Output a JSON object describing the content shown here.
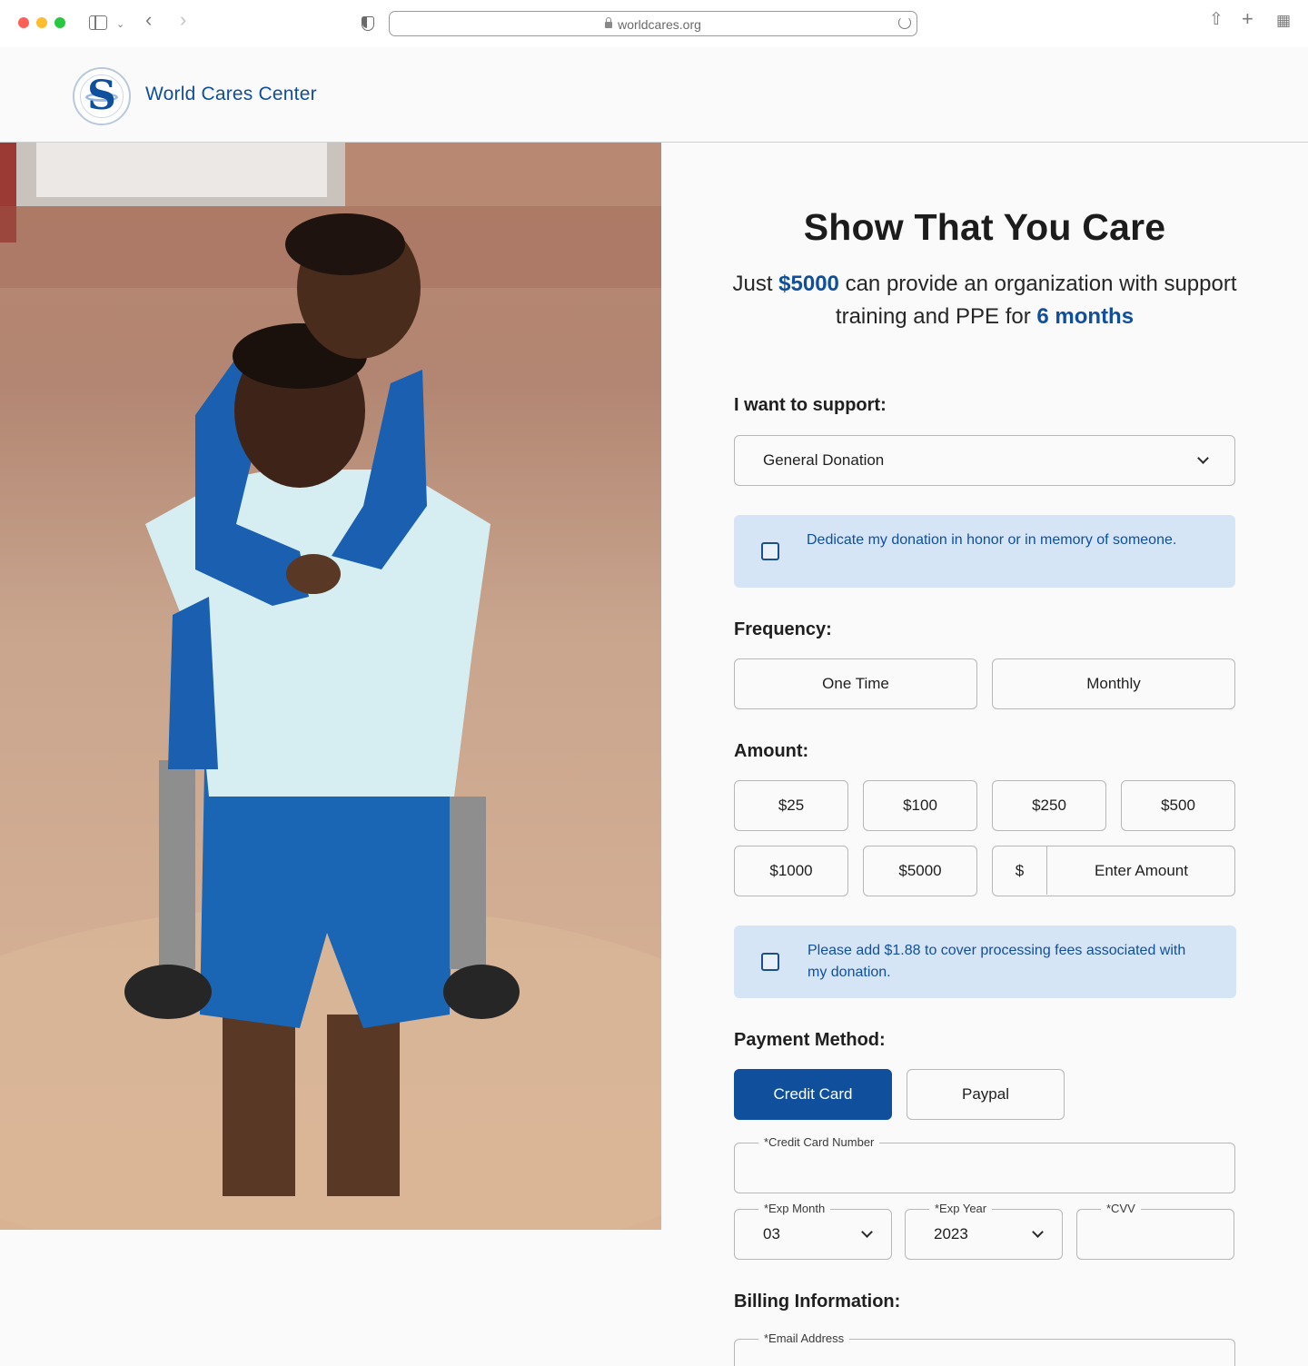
{
  "browser": {
    "url": "worldcares.org"
  },
  "header": {
    "brand_name": "World Cares Center"
  },
  "hero": {
    "alt": "Boy carrying a younger child on his back in the rain"
  },
  "form": {
    "title": "Show That You Care",
    "subtitle": {
      "part1": "Just ",
      "amount": "$5000",
      "part2": " can provide an organization with support training and PPE for ",
      "duration": "6 months"
    },
    "support_label": "I want to support:",
    "support_selected": "General Donation",
    "dedicate_text": "Dedicate my donation in honor or in memory of someone.",
    "frequency_label": "Frequency:",
    "frequency_options": [
      "One Time",
      "Monthly"
    ],
    "amount_label": "Amount:",
    "amount_options": [
      "$25",
      "$100",
      "$250",
      "$500",
      "$1000",
      "$5000"
    ],
    "custom_amount_prefix": "$",
    "custom_amount_placeholder": "Enter Amount",
    "fees_text": "Please add $1.88 to cover processing fees associated with my donation.",
    "payment_label": "Payment Method:",
    "payment_options": [
      "Credit Card",
      "Paypal"
    ],
    "card_number_label": "*Credit Card Number",
    "exp_month_label": "*Exp Month",
    "exp_month_value": "03",
    "exp_year_label": "*Exp Year",
    "exp_year_value": "2023",
    "cvv_label": "*CVV",
    "billing_label": "Billing Information:",
    "email_label": "*Email Address"
  },
  "colors": {
    "brand_blue": "#0f4f9c",
    "notice_bg": "#d6e5f6",
    "border": "#b7b7b7"
  }
}
